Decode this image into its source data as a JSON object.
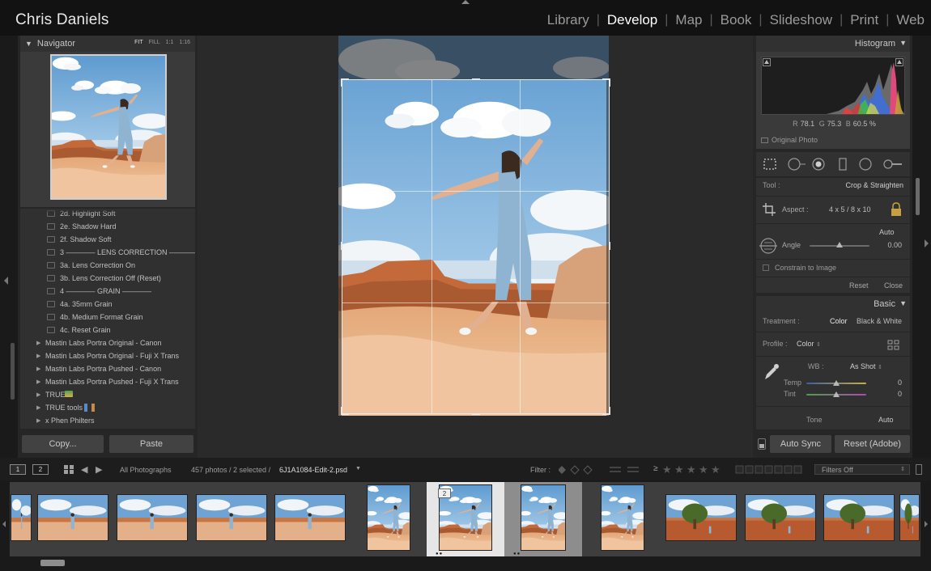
{
  "identity": "Chris Daniels",
  "modules": [
    {
      "label": "Library",
      "active": false
    },
    {
      "label": "Develop",
      "active": true
    },
    {
      "label": "Map",
      "active": false
    },
    {
      "label": "Book",
      "active": false
    },
    {
      "label": "Slideshow",
      "active": false
    },
    {
      "label": "Print",
      "active": false
    },
    {
      "label": "Web",
      "active": false
    }
  ],
  "navigator": {
    "title": "Navigator",
    "zoom_options": [
      "FIT",
      "FILL",
      "1:1",
      "1:16"
    ],
    "zoom_selected": "FIT"
  },
  "presets": [
    {
      "label": "2d. Highlight Soft",
      "type": "preset"
    },
    {
      "label": "2e. Shadow Hard",
      "type": "preset"
    },
    {
      "label": "2f. Shadow Soft",
      "type": "preset"
    },
    {
      "label": "3 ———— LENS CORRECTION ————",
      "type": "preset"
    },
    {
      "label": "3a. Lens Correction On",
      "type": "preset"
    },
    {
      "label": "3b. Lens Correction Off (Reset)",
      "type": "preset"
    },
    {
      "label": "4 ———— GRAIN ————",
      "type": "preset"
    },
    {
      "label": "4a. 35mm Grain",
      "type": "preset"
    },
    {
      "label": "4b. Medium Format Grain",
      "type": "preset"
    },
    {
      "label": "4c. Reset Grain",
      "type": "preset"
    },
    {
      "label": "Mastin Labs Portra Original - Canon",
      "type": "folder"
    },
    {
      "label": "Mastin Labs Portra Original - Fuji X Trans",
      "type": "folder"
    },
    {
      "label": "Mastin Labs Portra Pushed - Canon",
      "type": "folder"
    },
    {
      "label": "Mastin Labs Portra Pushed - Fuji X Trans",
      "type": "folder"
    },
    {
      "label": "TRUE",
      "type": "folder"
    },
    {
      "label": "TRUE tools",
      "type": "folder"
    },
    {
      "label": "x     Phen Philters",
      "type": "folder"
    }
  ],
  "left_buttons": {
    "copy": "Copy...",
    "paste": "Paste"
  },
  "histogram": {
    "title": "Histogram",
    "r_label": "R",
    "r_value": "78.1",
    "g_label": "G",
    "g_value": "75.3",
    "b_label": "B",
    "b_value": "60.5",
    "unit": "%",
    "original_photo": "Original Photo"
  },
  "crop_tool": {
    "tool_label": "Tool :",
    "tool_name": "Crop & Straighten",
    "aspect_label": "Aspect :",
    "aspect_value": "4 x 5  /  8 x 10",
    "auto": "Auto",
    "angle_label": "Angle",
    "angle_value": "0.00",
    "angle_position": 0.5,
    "constrain": "Constrain to Image",
    "reset": "Reset",
    "close": "Close"
  },
  "basic": {
    "title": "Basic",
    "treatment_label": "Treatment :",
    "treatment_color": "Color",
    "treatment_bw": "Black & White",
    "profile_label": "Profile :",
    "profile_value": "Color",
    "wb_label": "WB :",
    "wb_value": "As Shot",
    "temp_label": "Temp",
    "temp_value": "0",
    "temp_position": 0.5,
    "tint_label": "Tint",
    "tint_value": "0",
    "tint_position": 0.5,
    "tone_label": "Tone",
    "tone_auto": "Auto"
  },
  "right_buttons": {
    "auto_sync": "Auto Sync",
    "reset": "Reset (Adobe)"
  },
  "filmstrip_toolbar": {
    "view1": "1",
    "view2": "2",
    "source": "All Photographs",
    "count": "457 photos / 2 selected /",
    "filename": "6J1A1084-Edit-2.psd",
    "filter_label": "Filter :",
    "filters_off": "Filters Off"
  },
  "filmstrip": {
    "badge": "2"
  },
  "colors": {
    "panel": "#262626",
    "panel_header": "#313131",
    "sky": "#6fa8d8",
    "sand": "#e8b488",
    "jumpsuit": "#8fb4d2"
  }
}
